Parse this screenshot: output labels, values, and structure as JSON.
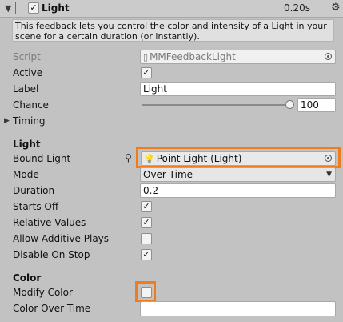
{
  "header": {
    "fold_icon": "triangle-down",
    "enabled_check": "✓",
    "title": "Light",
    "time": "0.20s",
    "menu_icon": "gear"
  },
  "help_text": "This feedback lets you control the color and intensity of a Light in your scene for a certain duration (or instantly).",
  "fields": {
    "script_label": "Script",
    "script_value": "MMFeedbackLight",
    "active_label": "Active",
    "active_checked": "✓",
    "label_label": "Label",
    "label_value": "Light",
    "chance_label": "Chance",
    "chance_value": "100",
    "timing_label": "Timing"
  },
  "light_section": {
    "heading": "Light",
    "bound_light_label": "Bound Light",
    "bound_light_value": "Point Light (Light)",
    "mode_label": "Mode",
    "mode_value": "Over Time",
    "duration_label": "Duration",
    "duration_value": "0.2",
    "starts_off_label": "Starts Off",
    "starts_off_checked": "✓",
    "relative_values_label": "Relative Values",
    "relative_values_checked": "✓",
    "allow_additive_label": "Allow Additive Plays",
    "allow_additive_checked": "",
    "disable_on_stop_label": "Disable On Stop",
    "disable_on_stop_checked": "✓"
  },
  "color_section": {
    "heading": "Color",
    "modify_color_label": "Modify Color",
    "modify_color_checked": "",
    "color_over_time_label": "Color Over Time"
  },
  "colors": {
    "highlight": "#f07c1e",
    "panel_bg": "#c2c2c2",
    "header_bg": "#cbcbcb"
  }
}
